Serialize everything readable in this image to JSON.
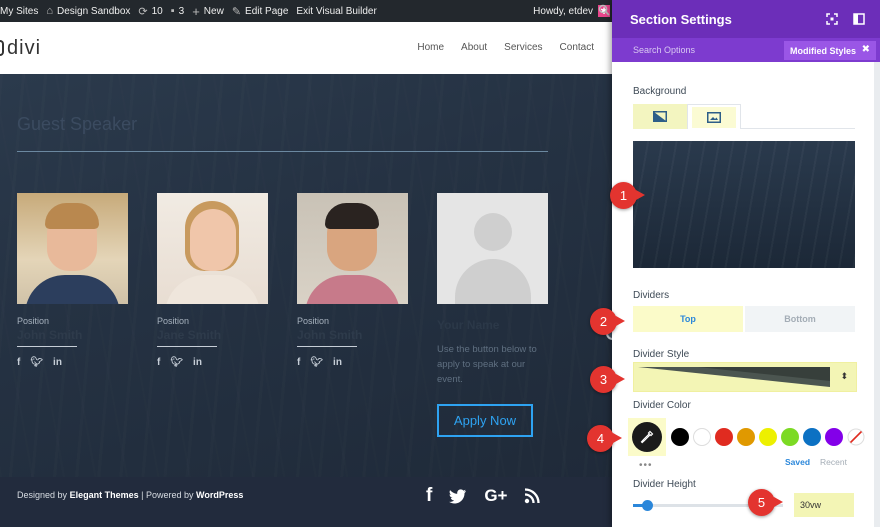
{
  "adminbar": {
    "my_sites": "My Sites",
    "site_name": "Design Sandbox",
    "updates_count": "10",
    "comments_count": "3",
    "new_label": "New",
    "edit_page": "Edit Page",
    "exit_builder": "Exit Visual Builder",
    "howdy": "Howdy, etdev"
  },
  "header": {
    "logo": "divi",
    "nav": [
      "Home",
      "About",
      "Services",
      "Contact"
    ]
  },
  "section": {
    "title": "Guest Speaker",
    "cards": [
      {
        "position": "Position",
        "name": "John Smith"
      },
      {
        "position": "Position",
        "name": "Jane Smith"
      },
      {
        "position": "Position",
        "name": "John Smith"
      },
      {
        "position": "",
        "name": "Your Name"
      }
    ],
    "cta_text": "Use the button below to apply to speak at our event.",
    "apply_label": "Apply Now"
  },
  "footer": {
    "designed_by": "Designed by",
    "elegant": "Elegant Themes",
    "powered": "| Powered by",
    "wordpress": "WordPress"
  },
  "panel": {
    "title": "Section Settings",
    "search_options": "Search Options",
    "modified_styles": "Modified Styles",
    "background_label": "Background",
    "dividers_label": "Dividers",
    "divider_tabs": [
      "Top",
      "Bottom"
    ],
    "divider_style_label": "Divider Style",
    "divider_color_label": "Divider Color",
    "saved_label": "Saved",
    "recent_label": "Recent",
    "divider_height_label": "Divider Height",
    "divider_height_value": "30vw",
    "slider_level": 0.09,
    "swatch_colors": [
      "#000000",
      "#ffffff",
      "#e02b20",
      "#e09900",
      "#edf000",
      "#7cda24",
      "#0c71c3",
      "#8300e9"
    ]
  },
  "callouts": [
    "1",
    "2",
    "3",
    "4",
    "5"
  ],
  "colors": {
    "accent": "#6c2eb9",
    "highlight": "#f3f5b5",
    "callout": "#e3342f",
    "link": "#2b87da"
  }
}
